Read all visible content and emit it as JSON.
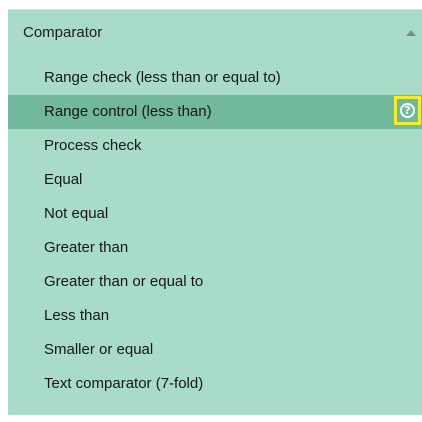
{
  "section": {
    "title": "Comparator",
    "collapse_icon": "chevron-up-icon"
  },
  "items": [
    {
      "label": "Range check (less than or equal to)"
    },
    {
      "label": "Range control (less than)",
      "selected": true
    },
    {
      "label": "Process check"
    },
    {
      "label": "Equal"
    },
    {
      "label": "Not equal"
    },
    {
      "label": "Greater than"
    },
    {
      "label": "Greater than or equal to"
    },
    {
      "label": "Less than"
    },
    {
      "label": "Smaller or equal"
    },
    {
      "label": "Text comparator (7-fold)"
    }
  ],
  "help": {
    "glyph": "?",
    "icon": "help-icon",
    "highlight_color": "#f4ee2a"
  },
  "colors": {
    "panel_background": "#a8dcc8",
    "selected_background": "#71b89c",
    "text": "#161616"
  }
}
